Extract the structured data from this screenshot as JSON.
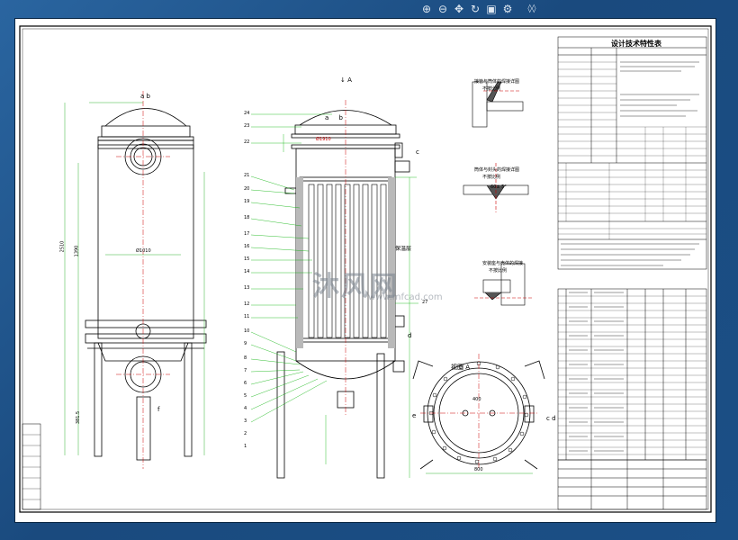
{
  "toolbar": {
    "icons": [
      "zoom-in-icon",
      "zoom-out-icon",
      "pan-icon",
      "refresh-icon",
      "layers-icon",
      "settings-icon"
    ],
    "page_indicator": "◊◊"
  },
  "drawing": {
    "section_label": "A",
    "view_label": "视图 A",
    "nozzle_letters": [
      "a",
      "b",
      "c",
      "d",
      "e",
      "f"
    ],
    "technical_table_title": "设计技术特性表",
    "detail_labels": [
      "接管与筒体的焊接详图",
      "筒体与封头的焊接详图",
      "安装座与壳体的焊接"
    ],
    "detail_sub": "不按比例",
    "weld_angle": "60± 5°",
    "part_numbers": [
      "24",
      "23",
      "22",
      "21",
      "20",
      "19",
      "18",
      "17",
      "16",
      "15",
      "14",
      "13",
      "12",
      "11",
      "10",
      "9",
      "8",
      "7",
      "6",
      "5",
      "4",
      "3",
      "2",
      "1"
    ],
    "right_number": "27",
    "dimension_texts": [
      "Ø1910",
      "Ø1500",
      "Ø1010",
      "1390",
      "2510",
      "381.5",
      "400",
      "800"
    ],
    "side_text": "保温层"
  },
  "watermark": {
    "brand": "沐风网",
    "url": "www.mfcad.com"
  },
  "colors": {
    "background": "#1d4f82",
    "sheet": "#ffffff",
    "outline": "#000000",
    "leader": "#00b000",
    "centerline": "#d00000",
    "hatch": "#a0a0a0"
  }
}
